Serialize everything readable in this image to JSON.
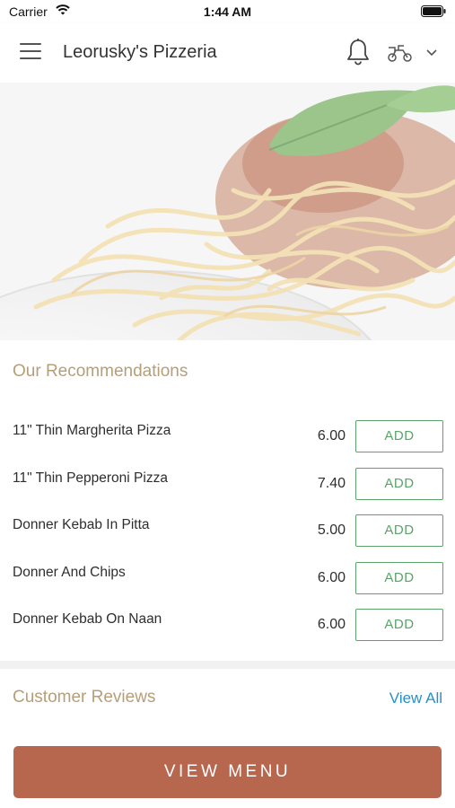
{
  "status_bar": {
    "carrier": "Carrier",
    "time": "1:44 AM"
  },
  "header": {
    "title": "Leorusky's Pizzeria",
    "icons": [
      "menu-icon",
      "bell-icon",
      "scooter-icon",
      "chevron-down-icon"
    ]
  },
  "recommendations": {
    "title": "Our Recommendations",
    "add_label": "ADD",
    "items": [
      {
        "name": "11\" Thin Margherita Pizza",
        "price": "6.00"
      },
      {
        "name": "11\" Thin Pepperoni Pizza",
        "price": "7.40"
      },
      {
        "name": "Donner Kebab In Pitta",
        "price": "5.00"
      },
      {
        "name": "Donner And Chips",
        "price": "6.00"
      },
      {
        "name": "Donner Kebab On Naan",
        "price": "6.00"
      }
    ]
  },
  "reviews": {
    "title": "Customer Reviews",
    "view_all": "View All"
  },
  "footer": {
    "view_menu": "VIEW MENU"
  },
  "colors": {
    "accent_gold": "#b79e78",
    "add_green": "#5aa36a",
    "link_blue": "#2a8fc4",
    "menu_button": "#b8674f"
  }
}
